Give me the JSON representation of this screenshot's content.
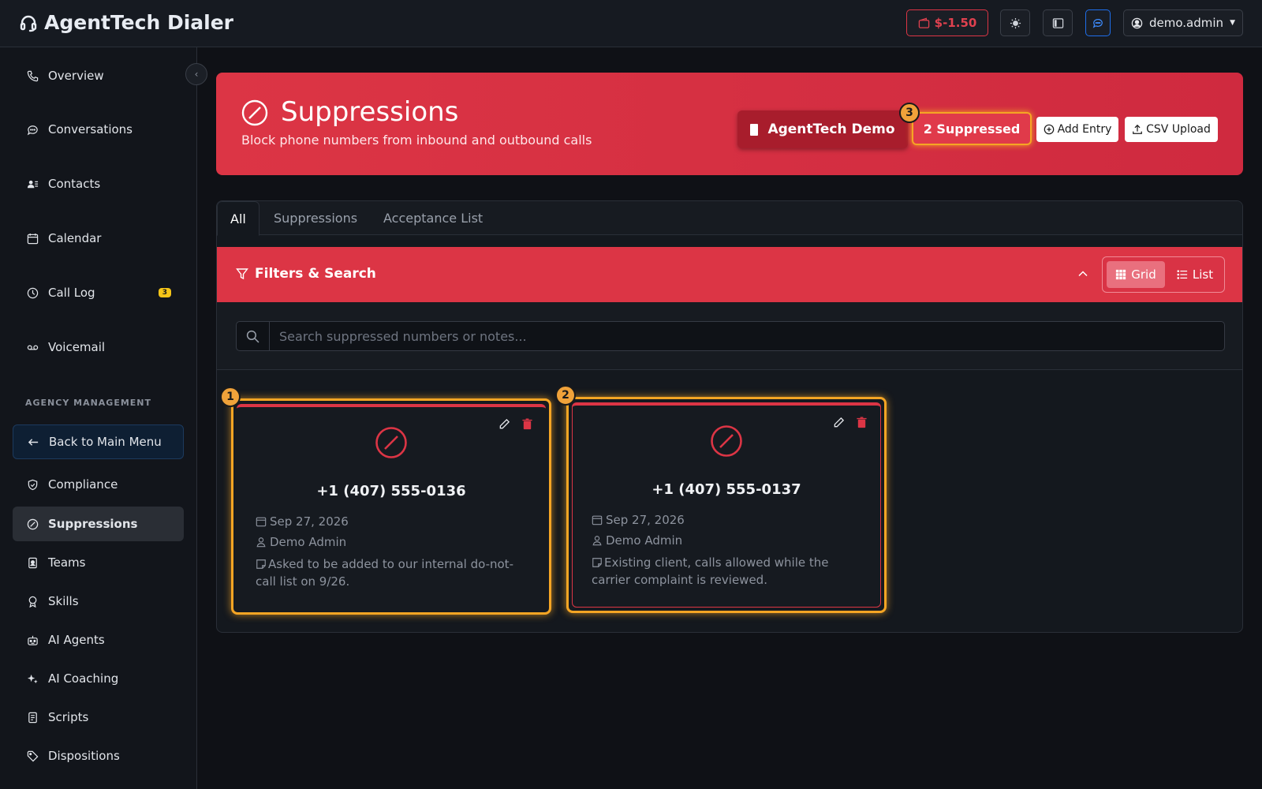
{
  "header": {
    "app_title": "AgentTech Dialer",
    "balance": "$-1.50",
    "user": "demo.admin",
    "colors": {
      "accent": "#dc3545",
      "highlight": "#f5a524",
      "info": "#3d8bfd"
    }
  },
  "sidebar": {
    "items": [
      {
        "label": "Overview",
        "icon": "phone-icon"
      },
      {
        "label": "Conversations",
        "icon": "chat-icon"
      },
      {
        "label": "Contacts",
        "icon": "contacts-icon"
      },
      {
        "label": "Calendar",
        "icon": "calendar-icon"
      },
      {
        "label": "Call Log",
        "icon": "clock-icon",
        "badge": "3"
      },
      {
        "label": "Voicemail",
        "icon": "voicemail-icon"
      }
    ],
    "section_label": "AGENCY MANAGEMENT",
    "agency_items": [
      {
        "label": "Back to Main Menu",
        "icon": "arrow-left-icon"
      },
      {
        "label": "Compliance",
        "icon": "shield-icon"
      },
      {
        "label": "Suppressions",
        "icon": "ban-icon",
        "active": true
      },
      {
        "label": "Teams",
        "icon": "badge-icon"
      },
      {
        "label": "Skills",
        "icon": "award-icon"
      },
      {
        "label": "AI Agents",
        "icon": "robot-icon"
      },
      {
        "label": "AI Coaching",
        "icon": "sparkle-icon"
      },
      {
        "label": "Scripts",
        "icon": "document-icon"
      },
      {
        "label": "Dispositions",
        "icon": "tag-icon"
      }
    ]
  },
  "hero": {
    "title": "Suppressions",
    "subtitle": "Block phone numbers from inbound and outbound calls",
    "org_name": "AgentTech Demo",
    "suppressed_count": "2 Suppressed",
    "marker": "3",
    "add_entry": "Add Entry",
    "csv_upload": "CSV Upload"
  },
  "tabs": [
    "All",
    "Suppressions",
    "Acceptance List"
  ],
  "filters": {
    "title": "Filters & Search",
    "view_grid": "Grid",
    "view_list": "List",
    "search_placeholder": "Search suppressed numbers or notes..."
  },
  "cards": [
    {
      "marker": "1",
      "phone": "+1 (407) 555-0136",
      "date": "Sep 27, 2026",
      "author": "Demo Admin",
      "note": "Asked to be added to our internal do-not-call list on 9/26."
    },
    {
      "marker": "2",
      "phone": "+1 (407) 555-0137",
      "date": "Sep 27, 2026",
      "author": "Demo Admin",
      "note": "Existing client, calls allowed while the carrier complaint is reviewed."
    }
  ]
}
